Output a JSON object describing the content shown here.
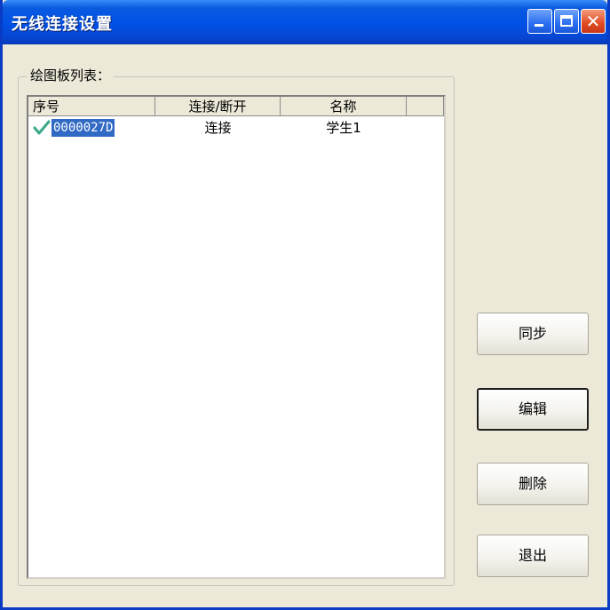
{
  "window": {
    "title": "无线连接设置"
  },
  "group": {
    "label": "绘图板列表："
  },
  "table": {
    "columns": [
      "序号",
      "连接/断开",
      "名称"
    ],
    "rows": [
      {
        "id": "0000027D",
        "status": "连接",
        "name": "学生1",
        "checked": true,
        "selected": true
      }
    ]
  },
  "buttons": {
    "sync": "同步",
    "edit": "编辑",
    "delete": "删除",
    "exit": "退出"
  },
  "colors": {
    "titlebar": "#0050e6",
    "selection": "#316ac5",
    "window_bg": "#ece9d8"
  }
}
